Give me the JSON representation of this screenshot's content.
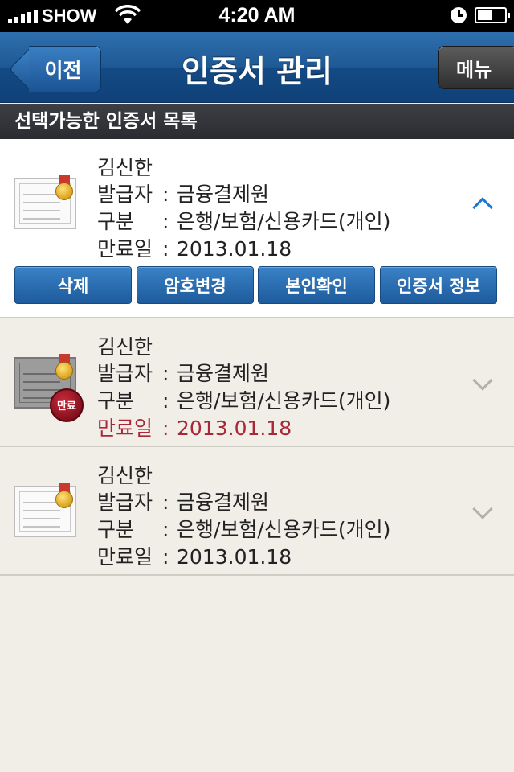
{
  "status_bar": {
    "carrier": "SHOW",
    "time": "4:20 AM"
  },
  "nav": {
    "back_label": "이전",
    "title": "인증서 관리",
    "menu_label": "메뉴"
  },
  "section_header": "선택가능한 인증서 목록",
  "certificates": [
    {
      "name": "김신한",
      "issuer_label": "발급자",
      "issuer": "금융결제원",
      "type_label": "구분",
      "type": "은행/보험/신용카드(개인)",
      "expiry_label": "만료일",
      "expiry": "2013.01.18",
      "expanded": true,
      "expired": false
    },
    {
      "name": "김신한",
      "issuer_label": "발급자",
      "issuer": "금융결제원",
      "type_label": "구분",
      "type": "은행/보험/신용카드(개인)",
      "expiry_label": "만료일",
      "expiry": "2013.01.18",
      "expanded": false,
      "expired": true,
      "expired_badge": "만료"
    },
    {
      "name": "김신한",
      "issuer_label": "발급자",
      "issuer": "금융결제원",
      "type_label": "구분",
      "type": "은행/보험/신용카드(개인)",
      "expiry_label": "만료일",
      "expiry": "2013.01.18",
      "expanded": false,
      "expired": false
    }
  ],
  "actions": {
    "delete": "삭제",
    "change_password": "암호변경",
    "verify_identity": "본인확인",
    "cert_info": "인증서 정보"
  },
  "colors": {
    "nav_blue": "#1e5994",
    "expired_red": "#a8283a",
    "chevron_blue": "#1b78d1",
    "list_background": "#f1ede7"
  },
  "separator": ":"
}
